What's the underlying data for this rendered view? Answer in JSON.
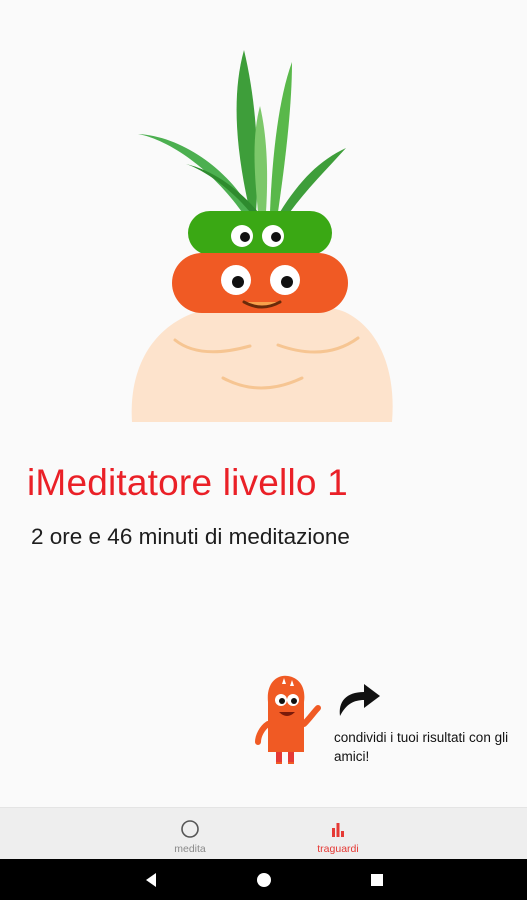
{
  "achievement": {
    "level_title": "iMeditatore livello 1",
    "total_time": "2 ore e 46 minuti di meditazione"
  },
  "share": {
    "text": "condividi i tuoi risultati con gli amici!"
  },
  "bottom_nav": {
    "items": [
      {
        "label": "medita",
        "icon": "circle-icon",
        "active": false
      },
      {
        "label": "traguardi",
        "icon": "bar-chart-icon",
        "active": true
      }
    ]
  },
  "system_nav": {
    "buttons": [
      "back-icon",
      "home-icon",
      "recents-icon"
    ]
  },
  "colors": {
    "accent": "#ea2027",
    "inactive": "#8a8a8a",
    "pot_green": "#3aa814",
    "pot_orange": "#f05a24",
    "body_peach": "#fde3cc",
    "leaf_green": "#4caf50"
  }
}
